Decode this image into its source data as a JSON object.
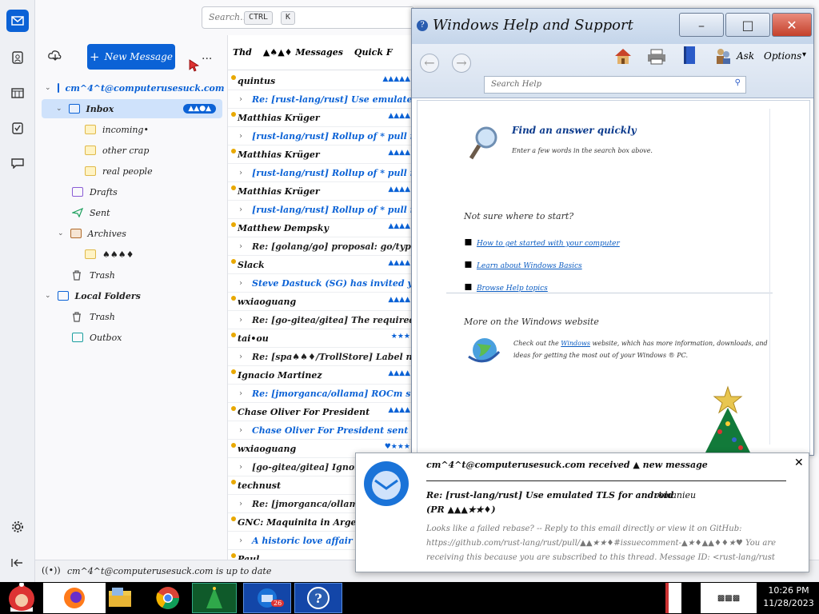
{
  "thunderbird": {
    "search_placeholder": "Search...",
    "search_kbd1": "CTRL",
    "search_kbd2": "K",
    "new_message": "New Message",
    "more": "...",
    "account": "cm^4^t@computerusesuck.com",
    "folders": {
      "inbox": "Inbox",
      "inbox_badge": "▲▲●▲",
      "incoming": "incoming•",
      "other_crap": "other crap",
      "real_people": "real people",
      "drafts": "Drafts",
      "sent": "Sent",
      "archives": "Archives",
      "archive_sub": "♠♠♠♦",
      "trash": "Trash",
      "local_folders": "Local Folders",
      "local_trash": "Trash",
      "outbox": "Outbox"
    },
    "list_header": {
      "col1": "Thd",
      "col2": "▲♠▲♦ Messages",
      "col3": "Quick F"
    },
    "messages": [
      {
        "sender": "quintus",
        "meta": "▲▲▲▲▲"
      },
      {
        "subject": "Re: [rust-lang/rust] Use emulated TLS for android"
      },
      {
        "sender": "Matthias Krüger",
        "meta": "▲▲▲▲"
      },
      {
        "subject": "[rust-lang/rust] Rollup of * pull requests"
      },
      {
        "sender": "Matthias Krüger",
        "meta": "▲▲▲▲"
      },
      {
        "subject": "[rust-lang/rust] Rollup of * pull requests"
      },
      {
        "sender": "Matthias Krüger",
        "meta": "▲▲▲▲"
      },
      {
        "subject": "[rust-lang/rust] Rollup of * pull requests"
      },
      {
        "sender": "Matthew Dempsky",
        "meta": "▲▲▲▲"
      },
      {
        "subject": "Re: [golang/go] proposal: go/types: add"
      },
      {
        "sender": "Slack",
        "meta": "▲▲▲▲"
      },
      {
        "subject": "Steve Dastuck (SG) has invited you to a"
      },
      {
        "sender": "wxiaoguang",
        "meta": "▲▲▲▲"
      },
      {
        "subject": "Re: [go-gitea/gitea] The required error"
      },
      {
        "sender": "tai•ou",
        "meta": "★★★"
      },
      {
        "subject": "Re: [spa♠♠♦/TrollStore] Label not in"
      },
      {
        "sender": "Ignacio Martinez",
        "meta": "▲▲▲▲"
      },
      {
        "subject": "Re: [jmorganca/ollama] ROCm support ("
      },
      {
        "sender": "Chase Oliver For President",
        "meta": "▲▲▲▲"
      },
      {
        "subject": "Chase Oliver For President sent you a new"
      },
      {
        "sender": "wxiaoguang",
        "meta": "♥★★★"
      },
      {
        "subject": "[go-gitea/gitea] Ignore \"no ..."
      },
      {
        "sender": "technust",
        "meta": "▲▲▲▲"
      },
      {
        "subject": "Re: [jmorganca/ollama] a"
      },
      {
        "sender": "GNC: Maquinita in Argentina",
        "meta": "▲▲▲▲"
      },
      {
        "subject": "A historic love affair"
      },
      {
        "sender": "Paul",
        "meta": ""
      }
    ],
    "status": "cm^4^t@computerusesuck.com is up to date"
  },
  "help": {
    "title": "Windows Help and Support",
    "ask": "Ask",
    "options": "Options",
    "search_placeholder": "Search Help",
    "find_heading": "Find an answer quickly",
    "find_text": "Enter a few words in the search box above.",
    "not_sure": "Not sure where to start?",
    "links": [
      "How to get started with your computer",
      "Learn about Windows Basics",
      "Browse Help topics"
    ],
    "more_heading": "More on the Windows website",
    "more_text_pre": "Check out the ",
    "more_link": "Windows",
    "more_text_post": " website, which has more information, downloads, and ideas for getting the most out of your Windows ® PC."
  },
  "notification": {
    "header": "cm^4^t@computerusesuck.com received ▲ new message",
    "subject": "Re: [rust-lang/rust] Use emulated TLS for android",
    "subject2": "(PR ▲▲▲★★♦)",
    "from": "Amanieu",
    "preview": "Looks like a failed rebase? -- Reply to this email directly or view it on GitHub: https://github.com/rust-lang/rust/pull/▲▲★★♦#issuecomment-▲★♦▲▲♦♦★♥ You are receiving this because you are subscribed to this thread. Message ID: <rust-lang/rust"
  },
  "taskbar": {
    "clock_time": "10:26 PM",
    "clock_date": "11/28/2023",
    "thunderbird_badge": "26"
  }
}
